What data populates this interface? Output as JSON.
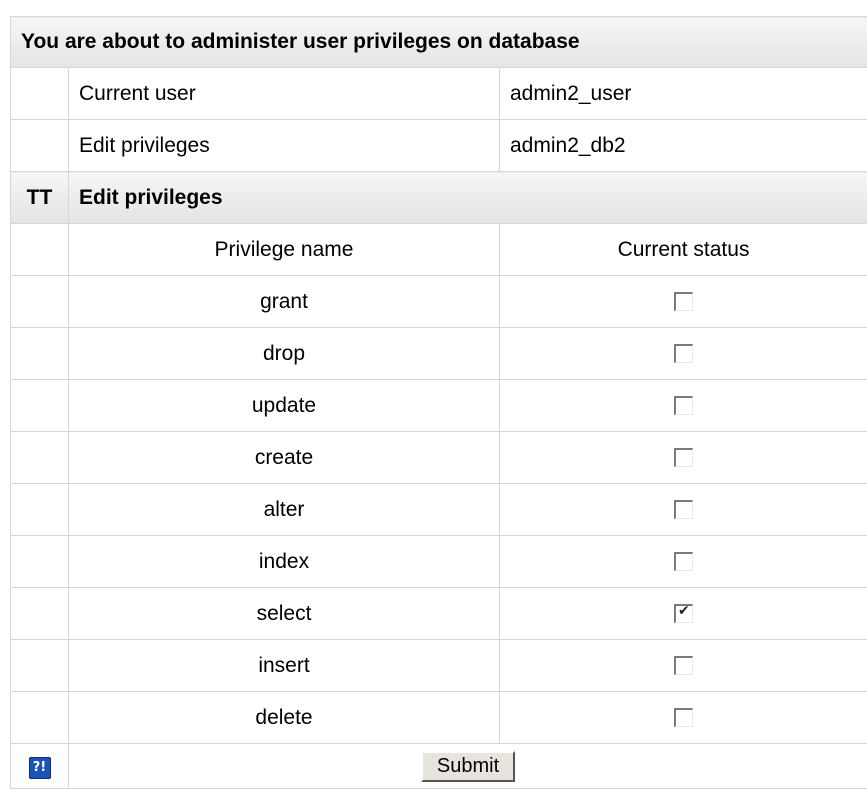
{
  "header": {
    "title": "You are about to administer user privileges on database"
  },
  "info": [
    {
      "label": "Current user",
      "value": "admin2_user"
    },
    {
      "label": "Edit privileges",
      "value": "admin2_db2"
    }
  ],
  "section": {
    "icon_text": "TT",
    "title": "Edit privileges"
  },
  "columns": {
    "name": "Privilege name",
    "status": "Current status"
  },
  "privileges": [
    {
      "name": "grant",
      "checked": false
    },
    {
      "name": "drop",
      "checked": false
    },
    {
      "name": "update",
      "checked": false
    },
    {
      "name": "create",
      "checked": false
    },
    {
      "name": "alter",
      "checked": false
    },
    {
      "name": "index",
      "checked": false
    },
    {
      "name": "select",
      "checked": true
    },
    {
      "name": "insert",
      "checked": false
    },
    {
      "name": "delete",
      "checked": false
    }
  ],
  "footer": {
    "help_icon": "?!",
    "submit_label": "Submit"
  }
}
